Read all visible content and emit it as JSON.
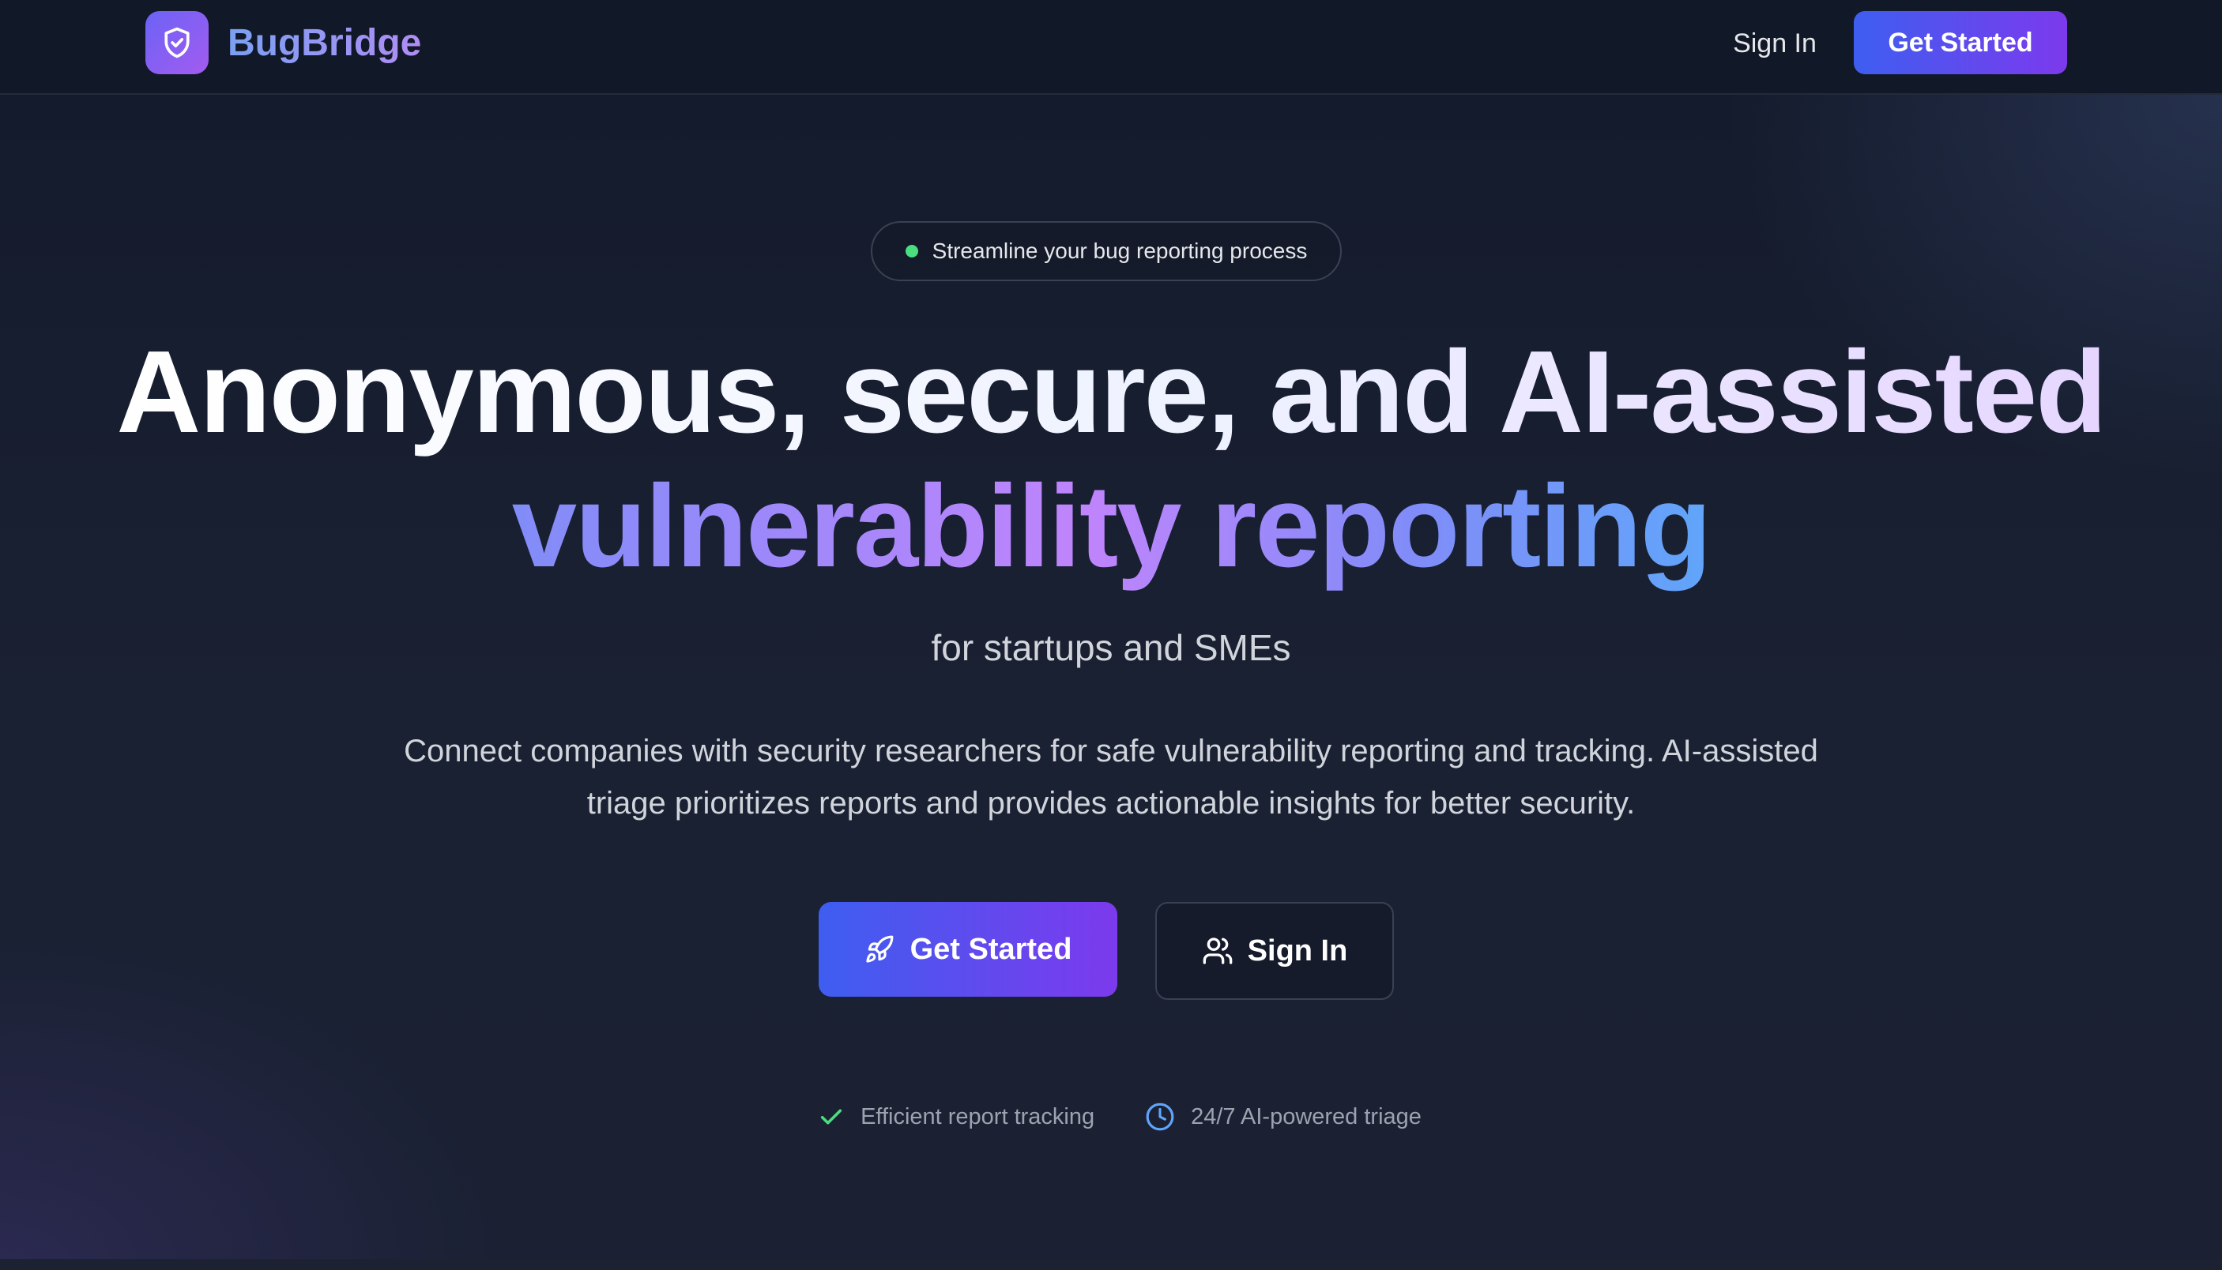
{
  "nav": {
    "brand": "BugBridge",
    "sign_in": "Sign In",
    "get_started": "Get Started"
  },
  "hero": {
    "badge": "Streamline your bug reporting process",
    "headline_line1": "Anonymous, secure, and AI-assisted",
    "headline_line2": "vulnerability reporting",
    "subheadline": "for startups and SMEs",
    "description": "Connect companies with security researchers for safe vulnerability reporting and tracking. AI-assisted triage prioritizes reports and provides actionable insights for better security.",
    "cta_primary": "Get Started",
    "cta_secondary": "Sign In"
  },
  "features": [
    {
      "icon": "check-icon",
      "label": "Efficient report tracking"
    },
    {
      "icon": "clock-icon",
      "label": "24/7 AI-powered triage"
    }
  ],
  "colors": {
    "accent_start": "#3e5ef0",
    "accent_end": "#7c3aed",
    "status_green": "#4ade80",
    "clock_blue": "#60a5fa",
    "background": "#161b2b"
  }
}
